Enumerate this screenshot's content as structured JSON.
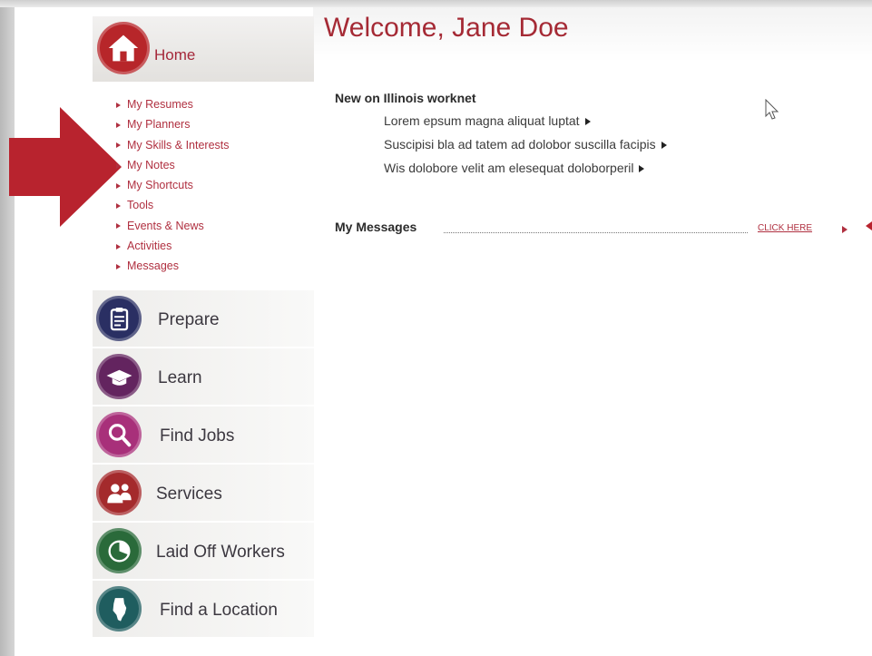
{
  "sidebar": {
    "home": {
      "label": "Home",
      "icon": "home-icon",
      "color": "#b7262a"
    },
    "submenu": [
      {
        "label": "My Resumes"
      },
      {
        "label": "My Planners"
      },
      {
        "label": "My Skills & Interests"
      },
      {
        "label": "My Notes"
      },
      {
        "label": "My Shortcuts"
      },
      {
        "label": "Tools"
      },
      {
        "label": "Events & News"
      },
      {
        "label": "Activities"
      },
      {
        "label": "Messages"
      }
    ],
    "nav": [
      {
        "label": "Prepare",
        "icon": "clipboard-icon",
        "color": "#2a2f63"
      },
      {
        "label": "Learn",
        "icon": "graduation-cap-icon",
        "color": "#63245f"
      },
      {
        "label": "Find Jobs",
        "icon": "magnifier-icon",
        "color": "#a8307a"
      },
      {
        "label": "Services",
        "icon": "people-icon",
        "color": "#a42a2c"
      },
      {
        "label": "Laid Off Workers",
        "icon": "pie-chart-icon",
        "color": "#2a6a3a"
      },
      {
        "label": "Find a Location",
        "icon": "illinois-map-icon",
        "color": "#1f5d5f"
      }
    ]
  },
  "main": {
    "welcome": "Welcome, Jane Doe",
    "new_heading": "New on Illinois worknet",
    "news": [
      "Lorem epsum magna aliquat luptat",
      "Suscipisi bla ad tatem ad dolobor suscilla facipis",
      "Wis dolobore velit am elesequat doloborperil"
    ],
    "messages_label": "My Messages",
    "click_here": "CLICK HERE"
  },
  "colors": {
    "accent": "#a52a35",
    "arrow": "#b8232e",
    "link": "#b03040"
  }
}
